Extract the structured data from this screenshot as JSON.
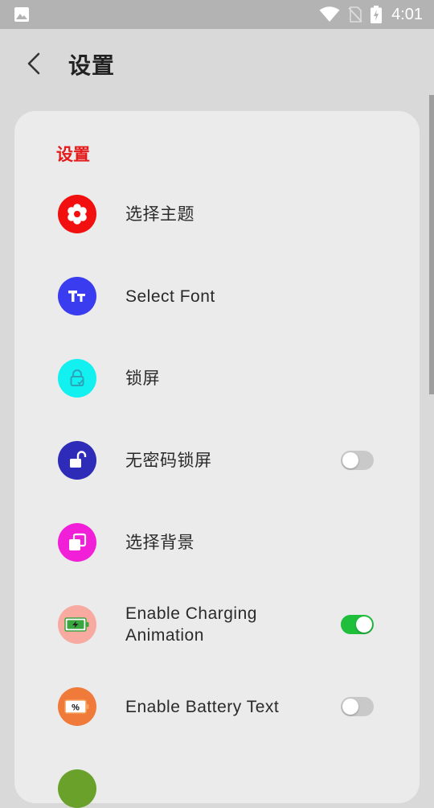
{
  "status_bar": {
    "time": "4:01",
    "icons": [
      "gallery-icon",
      "wifi-icon",
      "no-sim-icon",
      "battery-icon"
    ]
  },
  "header": {
    "title": "设置"
  },
  "section": {
    "title": "设置"
  },
  "items": [
    {
      "label": "选择主题",
      "icon": "flower-icon",
      "icon_color": "#f20f0f"
    },
    {
      "label": "Select Font",
      "icon": "font-icon",
      "icon_color": "#3a3cf0"
    },
    {
      "label": "锁屏",
      "icon": "lock-icon",
      "icon_color": "#12f0f0"
    },
    {
      "label": "无密码锁屏",
      "icon": "unlock-icon",
      "icon_color": "#2d2bb8",
      "toggle": false
    },
    {
      "label": "选择背景",
      "icon": "layers-icon",
      "icon_color": "#f21fd8"
    },
    {
      "label_line1": "Enable Charging",
      "label_line2": "Animation",
      "icon": "charging-battery-icon",
      "icon_color": "#f8a9a0",
      "toggle": true
    },
    {
      "label": "Enable Battery Text",
      "icon": "battery-percent-icon",
      "icon_color": "#f07a3a",
      "toggle": false
    }
  ],
  "colors": {
    "accent_red": "#e31b1b",
    "toggle_on": "#1fbe3b",
    "card_bg": "#ebebeb",
    "page_bg": "#d9d9d9"
  }
}
